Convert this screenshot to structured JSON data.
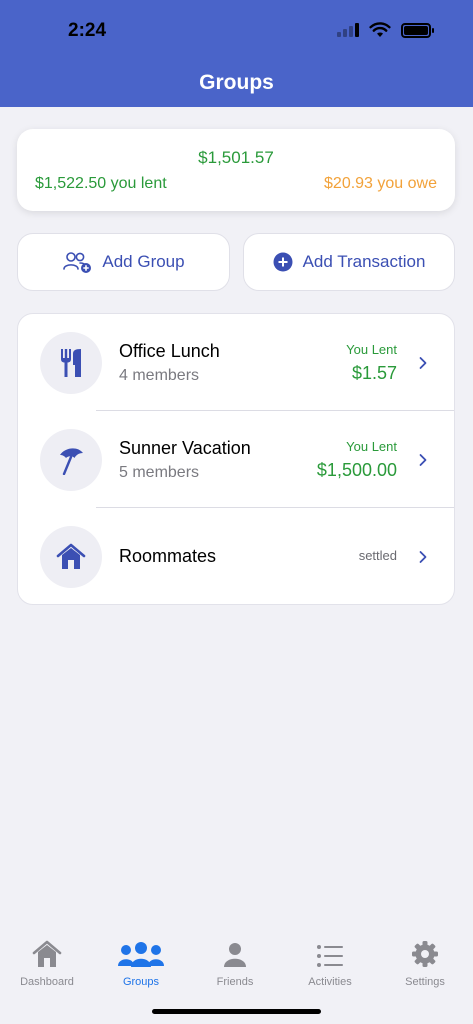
{
  "status_bar": {
    "time": "2:24"
  },
  "header": {
    "title": "Groups"
  },
  "summary": {
    "total": "$1,501.57",
    "lent": "$1,522.50 you lent",
    "owe": "$20.93 you owe",
    "colors": {
      "positive": "#2a9a3a",
      "owe": "#f2a23a"
    }
  },
  "actions": {
    "add_group": {
      "label": "Add Group",
      "icon": "add-user-group-icon"
    },
    "add_transaction": {
      "label": "Add Transaction",
      "icon": "plus-circle-icon"
    }
  },
  "groups": [
    {
      "name": "Office Lunch",
      "members": "4 members",
      "status": "You Lent",
      "amount": "$1.57",
      "icon": "fork-knife-icon"
    },
    {
      "name": "Sunner Vacation",
      "members": "5 members",
      "status": "You Lent",
      "amount": "$1,500.00",
      "icon": "beach-umbrella-icon"
    },
    {
      "name": "Roommates",
      "members": "",
      "status": "settled",
      "amount": "",
      "icon": "house-icon"
    }
  ],
  "tabs": [
    {
      "label": "Dashboard",
      "icon": "house-icon",
      "active": false
    },
    {
      "label": "Groups",
      "icon": "people-group-icon",
      "active": true
    },
    {
      "label": "Friends",
      "icon": "person-icon",
      "active": false
    },
    {
      "label": "Activities",
      "icon": "list-icon",
      "active": false
    },
    {
      "label": "Settings",
      "icon": "gear-icon",
      "active": false
    }
  ],
  "accent": "#4a64c9",
  "tab_active_color": "#1f74e8"
}
